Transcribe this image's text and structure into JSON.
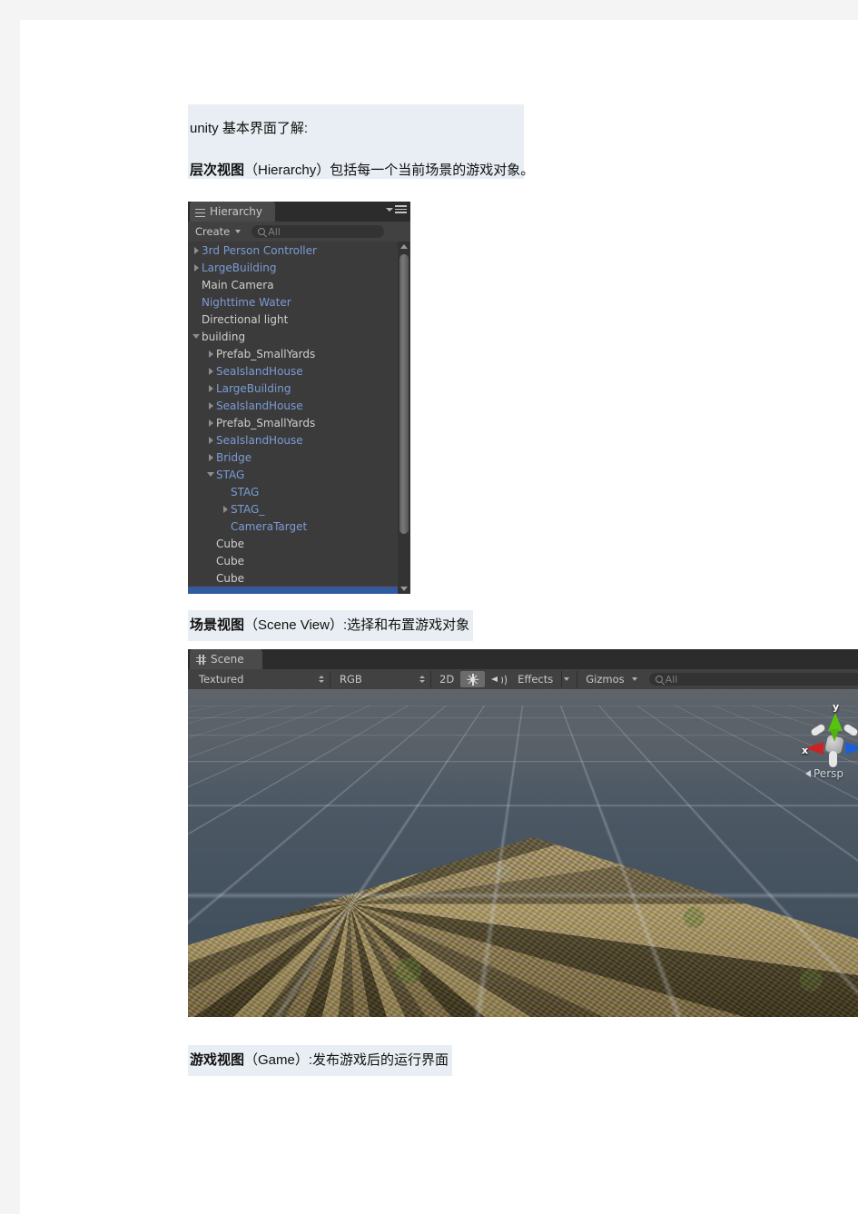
{
  "document": {
    "intro_line1": "unity 基本界面了解:",
    "intro_line2_bold": "层次视图",
    "intro_line2_rest": "（Hierarchy）包括每一个当前场景的游戏对象。",
    "caption_scene_bold": "场景视图",
    "caption_scene_rest": "（Scene View）:选择和布置游戏对象",
    "caption_game_bold": "游戏视图",
    "caption_game_rest": "（Game）:发布游戏后的运行界面"
  },
  "hierarchy_panel": {
    "tab_label": "Hierarchy",
    "create_label": "Create",
    "search_placeholder": "All",
    "items": [
      {
        "label": "3rd Person Controller",
        "depth": 0,
        "arrow": "right",
        "color": "blue"
      },
      {
        "label": "LargeBuilding",
        "depth": 0,
        "arrow": "right",
        "color": "blue"
      },
      {
        "label": "Main Camera",
        "depth": 0,
        "arrow": "none",
        "color": "white"
      },
      {
        "label": "Nighttime Water",
        "depth": 0,
        "arrow": "none",
        "color": "blue"
      },
      {
        "label": "Directional light",
        "depth": 0,
        "arrow": "none",
        "color": "white"
      },
      {
        "label": "building",
        "depth": 0,
        "arrow": "down",
        "color": "white"
      },
      {
        "label": "Prefab_SmallYards",
        "depth": 1,
        "arrow": "right",
        "color": "white"
      },
      {
        "label": "SeaIslandHouse",
        "depth": 1,
        "arrow": "right",
        "color": "blue"
      },
      {
        "label": "LargeBuilding",
        "depth": 1,
        "arrow": "right",
        "color": "blue"
      },
      {
        "label": "SeaIslandHouse",
        "depth": 1,
        "arrow": "right",
        "color": "blue"
      },
      {
        "label": "Prefab_SmallYards",
        "depth": 1,
        "arrow": "right",
        "color": "white"
      },
      {
        "label": "SeaIslandHouse",
        "depth": 1,
        "arrow": "right",
        "color": "blue"
      },
      {
        "label": "Bridge",
        "depth": 1,
        "arrow": "right",
        "color": "blue"
      },
      {
        "label": "STAG",
        "depth": 1,
        "arrow": "down",
        "color": "blue"
      },
      {
        "label": "STAG",
        "depth": 2,
        "arrow": "none",
        "color": "blue"
      },
      {
        "label": "STAG_",
        "depth": 2,
        "arrow": "right",
        "color": "blue"
      },
      {
        "label": "CameraTarget",
        "depth": 2,
        "arrow": "none",
        "color": "blue"
      },
      {
        "label": "Cube",
        "depth": 1,
        "arrow": "none",
        "color": "white"
      },
      {
        "label": "Cube",
        "depth": 1,
        "arrow": "none",
        "color": "white"
      },
      {
        "label": "Cube",
        "depth": 1,
        "arrow": "none",
        "color": "white"
      }
    ],
    "colors": {
      "panel_bg": "#3b3b3b",
      "toolbar_bg": "#414141",
      "prefab_blue": "#7b9bd4",
      "normal_text": "#cfcfcf",
      "selection_blue": "#2f5c9e"
    }
  },
  "scene_view": {
    "tab_label": "Scene",
    "draw_mode": "Textured",
    "color_mode": "RGB",
    "toggle_2d": "2D",
    "lighting_icon": "sun-icon",
    "audio_icon": "speaker-icon",
    "effects_label": "Effects",
    "gizmos_label": "Gizmos",
    "search_placeholder": "All",
    "gizmo": {
      "axis_y_label": "y",
      "axis_x_label": "x",
      "projection_label": "Persp",
      "color_x": "#cc2222",
      "color_y": "#55c40f",
      "color_z": "#1b5fd6"
    },
    "viewport": {
      "sky_color": "#5b6066",
      "grid_color": "#d2dae2",
      "terrain_color": "#7d7560",
      "grass_color": "#6e8240"
    }
  }
}
